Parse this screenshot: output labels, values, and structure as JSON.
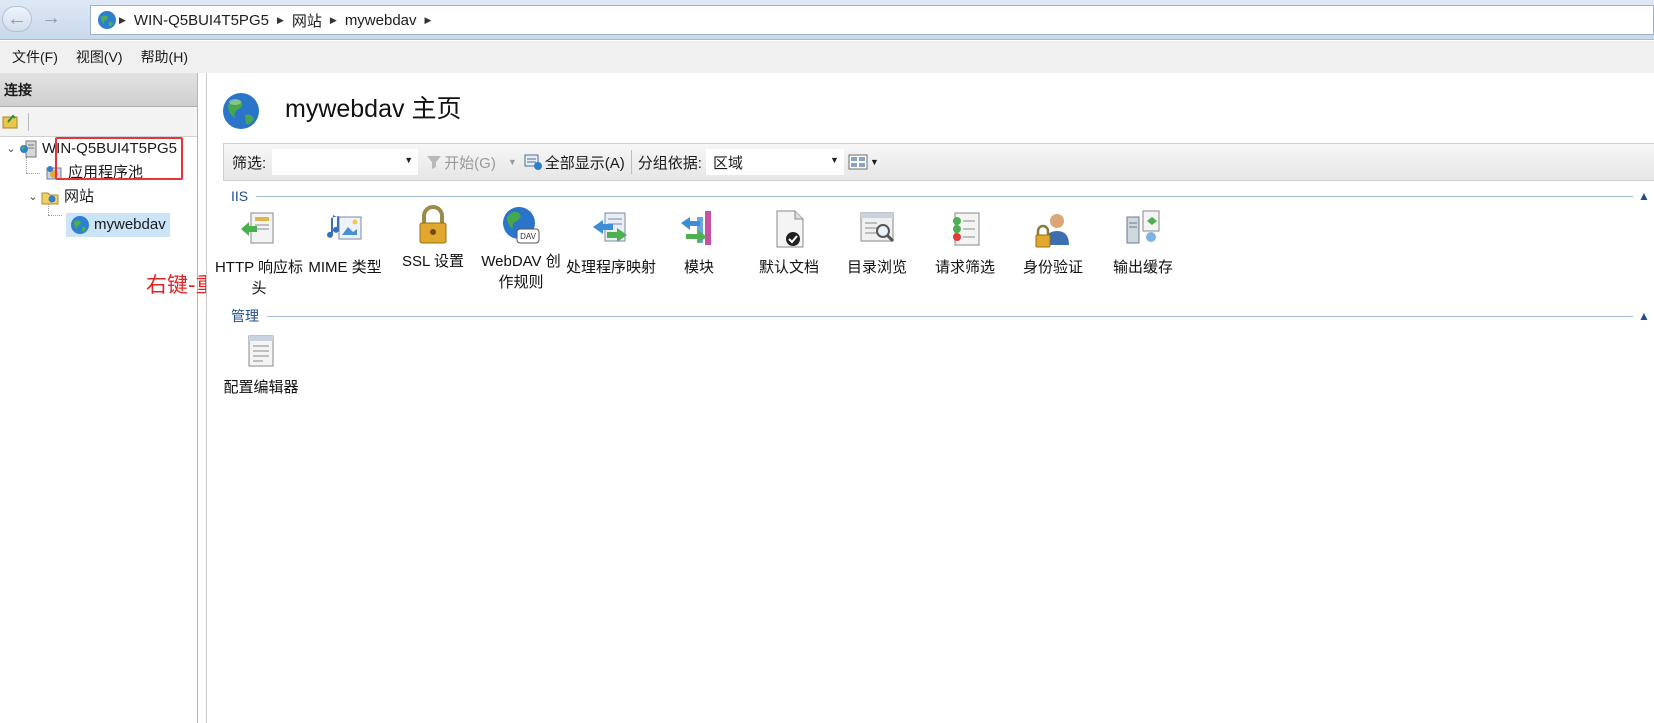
{
  "address_bar": {
    "breadcrumbs": [
      "WIN-Q5BUI4T5PG5",
      "网站",
      "mywebdav"
    ]
  },
  "menu": {
    "items": [
      "文件(F)",
      "视图(V)",
      "帮助(H)"
    ]
  },
  "connections": {
    "title": "连接",
    "tree": {
      "server": "WIN-Q5BUI4T5PG5",
      "app_pools": "应用程序池",
      "sites": "网站",
      "selected_site": "mywebdav"
    },
    "annotation": "右键-重启",
    "annotation_color": "#e02424"
  },
  "main": {
    "title": "mywebdav 主页",
    "filter": {
      "label": "筛选:",
      "value": "",
      "start_label": "开始(G)",
      "show_all_label": "全部显示(A)",
      "group_by_label": "分组依据:",
      "group_by_value": "区域"
    },
    "groups": {
      "iis": {
        "label": "IIS",
        "features": [
          {
            "label": "HTTP 响应标头",
            "icon": "http-response-headers-icon"
          },
          {
            "label": "MIME 类型",
            "icon": "mime-types-icon"
          },
          {
            "label": "SSL 设置",
            "icon": "ssl-lock-icon"
          },
          {
            "label": "WebDAV 创作规则",
            "icon": "webdav-icon"
          },
          {
            "label": "处理程序映射",
            "icon": "handler-mappings-icon"
          },
          {
            "label": "模块",
            "icon": "modules-icon"
          },
          {
            "label": "默认文档",
            "icon": "default-document-icon"
          },
          {
            "label": "目录浏览",
            "icon": "directory-browsing-icon"
          },
          {
            "label": "请求筛选",
            "icon": "request-filtering-icon"
          },
          {
            "label": "身份验证",
            "icon": "authentication-icon"
          },
          {
            "label": "输出缓存",
            "icon": "output-caching-icon"
          }
        ]
      },
      "management": {
        "label": "管理",
        "features": [
          {
            "label": "配置编辑器",
            "icon": "configuration-editor-icon"
          }
        ]
      }
    }
  },
  "colors": {
    "accent": "#1f4f8a",
    "selection": "#cce4f7",
    "highlight": "#e8333a"
  }
}
